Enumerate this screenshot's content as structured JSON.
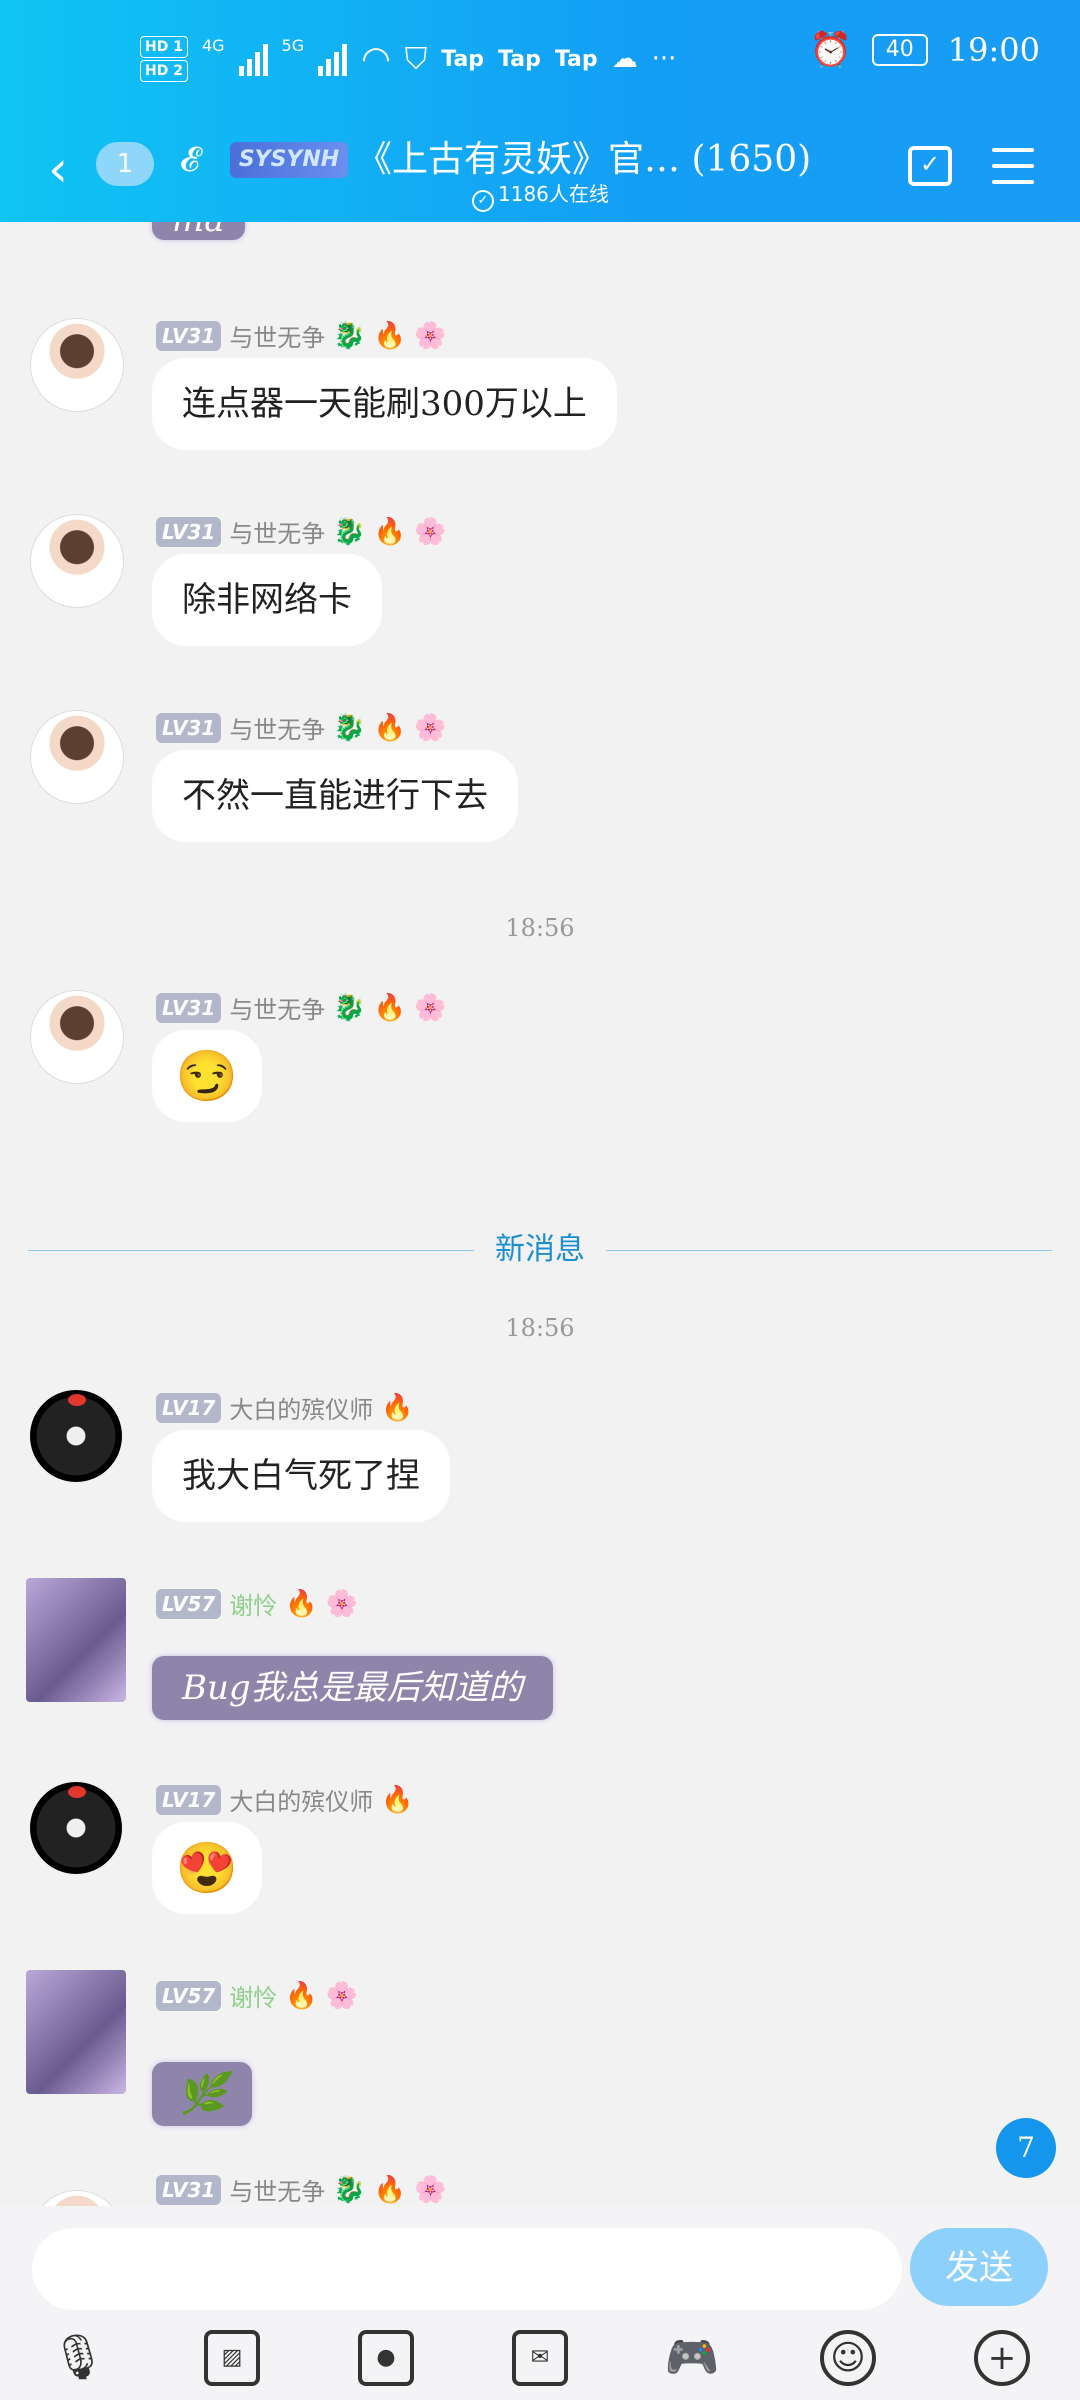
{
  "status_bar": {
    "hd1": "HD 1",
    "hd2": "HD 2",
    "net1": "4G",
    "net2": "5G",
    "apps": [
      "Tap",
      "Tap",
      "Tap"
    ],
    "more": "···",
    "battery": "40",
    "time": "19:00"
  },
  "header": {
    "unread_badge": "1",
    "logo_text": "SYSYNH",
    "title": "《上古有灵妖》官… (1650)",
    "online": "1186人在线"
  },
  "messages": [
    {
      "level": "LV31",
      "name": "与世无争",
      "text": "连点器一天能刷300万以上"
    },
    {
      "level": "LV31",
      "name": "与世无争",
      "text": "除非网络卡"
    },
    {
      "level": "LV31",
      "name": "与世无争",
      "text": "不然一直能进行下去"
    },
    {
      "level": "LV31",
      "name": "与世无争",
      "text": "😏"
    },
    {
      "level": "LV17",
      "name": "大白的殡仪师",
      "text": "我大白气死了捏"
    },
    {
      "level": "LV57",
      "name": "谢怜",
      "text": "Bug我总是最后知道的"
    },
    {
      "level": "LV17",
      "name": "大白的殡仪师",
      "text": "😍"
    },
    {
      "level": "LV57",
      "name": "谢怜",
      "text": "🌿"
    },
    {
      "level": "LV31",
      "name": "与世无争",
      "text": ""
    }
  ],
  "top_partial": "ma",
  "times": [
    "18:56",
    "18:56"
  ],
  "new_messages_label": "新消息",
  "unread_count": "7",
  "composer": {
    "placeholder": "",
    "send_label": "发送"
  },
  "toolbar_icons": [
    "microphone-icon",
    "image-icon",
    "camera-icon",
    "red-packet-icon",
    "game-icon",
    "emoji-icon",
    "plus-icon"
  ],
  "colors": {
    "header_start": "#10c4f4",
    "header_end": "#1a9cf5",
    "accent": "#1496ed",
    "send_button": "#8dd0fb"
  }
}
